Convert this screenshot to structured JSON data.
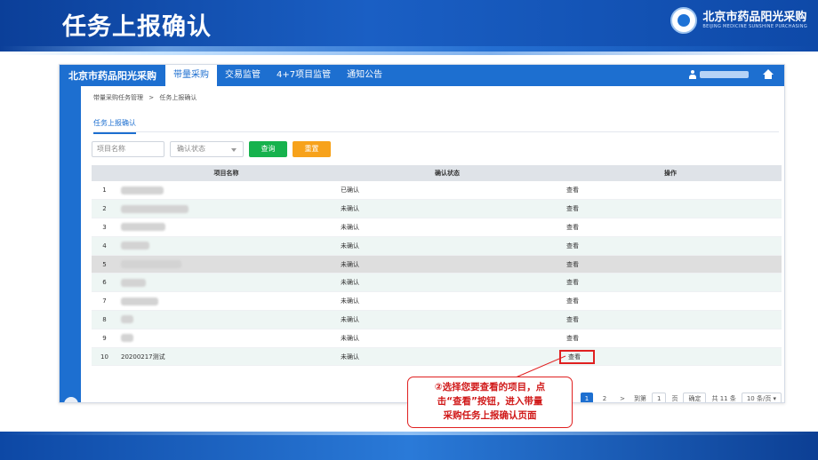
{
  "slide": {
    "title": "任务上报确认",
    "brand_name": "北京市药品阳光采购",
    "brand_sub": "BEIJING MEDICINE SUNSHINE PURCHASING"
  },
  "topnav": {
    "logo": "北京市药品阳光采购",
    "items": [
      "带量采购",
      "交易监管",
      "4+7项目监管",
      "通知公告"
    ],
    "active_index": 0
  },
  "breadcrumb": [
    "带量采购任务管理",
    ">",
    "任务上报确认"
  ],
  "tab": "任务上报确认",
  "filters": {
    "name_placeholder": "项目名称",
    "status_select": "确认状态",
    "search_label": "查询",
    "reset_label": "重置"
  },
  "table": {
    "headers": [
      "",
      "项目名称",
      "确认状态",
      "操作"
    ],
    "rows": [
      {
        "index": "1",
        "name": "",
        "status": "已确认",
        "action": "查看"
      },
      {
        "index": "2",
        "name": "",
        "status": "未确认",
        "action": "查看"
      },
      {
        "index": "3",
        "name": "",
        "status": "未确认",
        "action": "查看"
      },
      {
        "index": "4",
        "name": "",
        "status": "未确认",
        "action": "查看"
      },
      {
        "index": "5",
        "name": "",
        "status": "未确认",
        "action": "查看"
      },
      {
        "index": "6",
        "name": "",
        "status": "未确认",
        "action": "查看"
      },
      {
        "index": "7",
        "name": "",
        "status": "未确认",
        "action": "查看"
      },
      {
        "index": "8",
        "name": "",
        "status": "未确认",
        "action": "查看"
      },
      {
        "index": "9",
        "name": "",
        "status": "未确认",
        "action": "查看"
      },
      {
        "index": "10",
        "name": "20200217测试",
        "status": "未确认",
        "action": "查看"
      }
    ]
  },
  "pagination": {
    "pages": [
      "1",
      "2"
    ],
    "current": "1",
    "next": ">",
    "goto_label": "到第",
    "goto_value": "1",
    "page_unit": "页",
    "confirm": "确定",
    "total": "共 11 条",
    "page_size": "10 条/页"
  },
  "callout": {
    "line1": "②选择您要查看的项目，点",
    "line2": "击“查看”按钮，进入带量",
    "line3": "采购任务上报确认页面"
  },
  "colors": {
    "primary": "#1d6fd0",
    "search_button": "#16b24d",
    "reset_button": "#f7a21b",
    "callout": "#e02020"
  }
}
